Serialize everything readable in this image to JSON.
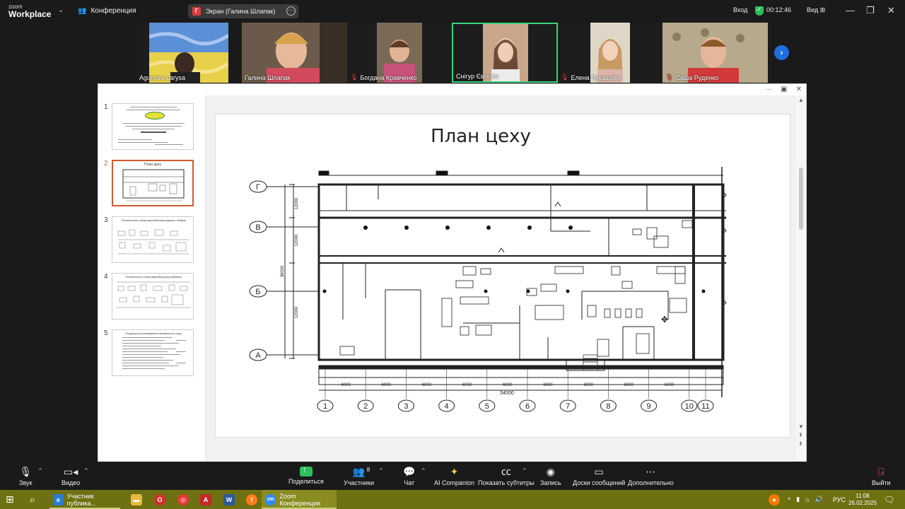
{
  "titlebar": {
    "logo_line1": "zoom",
    "logo_line2": "Workplace",
    "meeting_label": "Конференция",
    "share_label": "Экран (Галина Шлапак)",
    "share_badge": "Г",
    "login": "Вход",
    "timer": "00:12:46",
    "view": "Вид"
  },
  "participants": [
    {
      "name": "Agunova Larysa",
      "muted": false
    },
    {
      "name": "Галина Шлапак",
      "muted": false
    },
    {
      "name": "Богдана Кравченко",
      "muted": true
    },
    {
      "name": "Снігур Євгенія",
      "muted": false
    },
    {
      "name": "Елена Лукашова",
      "muted": true
    },
    {
      "name": "Саша Руденко",
      "muted": true
    }
  ],
  "slides": {
    "numbers": [
      "1",
      "2",
      "3",
      "4",
      "5"
    ],
    "selected": 2,
    "thumb2_title": "План цеху",
    "thumb3_title": "Технологічна схема виробництва курячих табаків",
    "thumb4_title": "Технологічна схема виробництва ковбасок",
    "thumb5_title": "Розрахунок устаткування механічного цеху"
  },
  "slide": {
    "title": "План цеху",
    "axes_rows": [
      "Г",
      "В",
      "Б",
      "А"
    ],
    "axes_cols": [
      "1",
      "2",
      "3",
      "4",
      "5",
      "6",
      "7",
      "8",
      "9",
      "10",
      "11"
    ],
    "dim_row": [
      "6000",
      "6000",
      "6000",
      "6000",
      "6000",
      "6000",
      "6000",
      "6000",
      "6000"
    ],
    "dim_total": "54000",
    "dim_side": [
      "12000",
      "12000",
      "12000"
    ],
    "dim_side_total": "36000"
  },
  "controls": {
    "audio": "Звук",
    "video": "Видео",
    "share": "Поделиться",
    "participants": "Участники",
    "participants_count": "8",
    "chat": "Чат",
    "ai": "AI Companion",
    "captions": "Показать субтитры",
    "record": "Запись",
    "boards": "Доски сообщений",
    "more": "Дополнительно",
    "leave": "Выйти"
  },
  "taskbar": {
    "app1": "Участник публика...",
    "app2": "Zoom Конференция",
    "lang": "РУС",
    "time": "11:08",
    "date": "26.02.2025"
  }
}
